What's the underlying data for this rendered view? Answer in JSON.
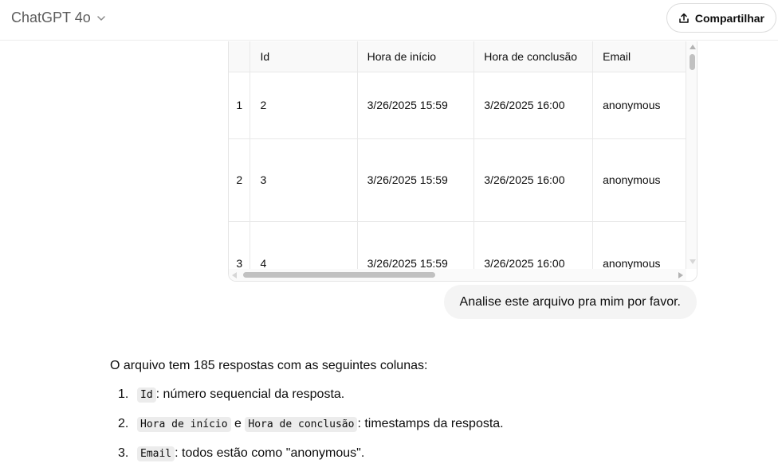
{
  "header": {
    "model_name": "ChatGPT 4o",
    "share_label": "Compartilhar"
  },
  "table": {
    "columns": [
      "",
      "Id",
      "Hora de início",
      "Hora de conclusão",
      "Email"
    ],
    "rows": [
      [
        "1",
        "2",
        "3/26/2025 15:59",
        "3/26/2025 16:00",
        "anonymous"
      ],
      [
        "2",
        "3",
        "3/26/2025 15:59",
        "3/26/2025 16:00",
        "anonymous"
      ],
      [
        "3",
        "4",
        "3/26/2025 15:59",
        "3/26/2025 16:00",
        "anonymous"
      ]
    ]
  },
  "user_message": "Analise este arquivo pra mim por favor.",
  "assistant": {
    "intro": "O arquivo tem 185 respostas com as seguintes colunas:",
    "items": [
      {
        "num": "1.",
        "code1": "Id",
        "text1": ": número sequencial da resposta."
      },
      {
        "num": "2.",
        "code1": "Hora de início",
        "mid": " e ",
        "code2": "Hora de conclusão",
        "text1": ": timestamps da resposta."
      },
      {
        "num": "3.",
        "code1": "Email",
        "text1": ": todos estão como \"anonymous\"."
      }
    ]
  }
}
